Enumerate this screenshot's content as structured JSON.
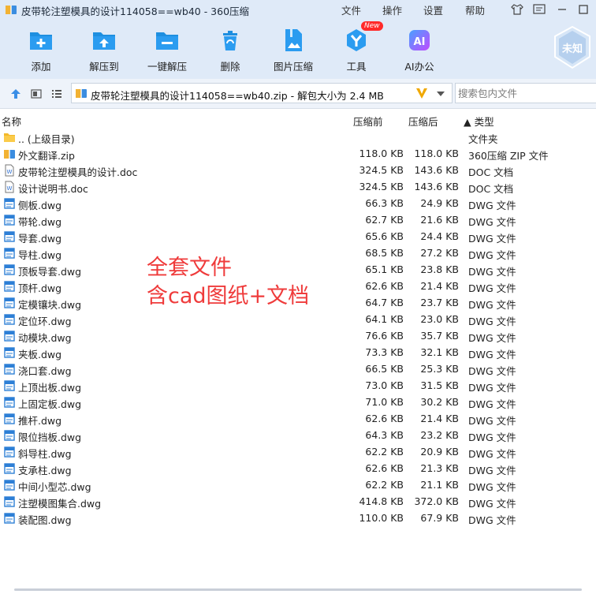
{
  "window": {
    "title": "皮带轮注塑模具的设计114058==wb40 - 360压缩",
    "menu": [
      "文件",
      "操作",
      "设置",
      "帮助"
    ]
  },
  "toolbar": [
    {
      "label": "添加",
      "icon": "add-icon"
    },
    {
      "label": "解压到",
      "icon": "extract-to-icon"
    },
    {
      "label": "一键解压",
      "icon": "one-click-extract-icon"
    },
    {
      "label": "删除",
      "icon": "delete-icon"
    },
    {
      "label": "图片压缩",
      "icon": "image-compress-icon"
    },
    {
      "label": "工具",
      "icon": "tools-icon",
      "badge": "New"
    },
    {
      "label": "AI办公",
      "icon": "ai-office-icon"
    }
  ],
  "user": {
    "avatar_text": "未知"
  },
  "pathbar": {
    "path": "皮带轮注塑模具的设计114058==wb40.zip - 解包大小为 2.4 MB",
    "search_placeholder": "搜索包内文件"
  },
  "columns": {
    "name": "名称",
    "original": "压缩前",
    "compressed": "压缩后",
    "type": "▲ 类型"
  },
  "files": [
    {
      "name": ".. (上级目录)",
      "size": "",
      "compressed": "",
      "type": "文件夹",
      "kind": "folder"
    },
    {
      "name": "外文翻译.zip",
      "size": "118.0 KB",
      "compressed": "118.0 KB",
      "type": "360压缩 ZIP 文件",
      "kind": "zip"
    },
    {
      "name": "皮带轮注塑模具的设计.doc",
      "size": "324.5 KB",
      "compressed": "143.6 KB",
      "type": "DOC 文档",
      "kind": "doc"
    },
    {
      "name": "设计说明书.doc",
      "size": "324.5 KB",
      "compressed": "143.6 KB",
      "type": "DOC 文档",
      "kind": "doc"
    },
    {
      "name": "侧板.dwg",
      "size": "66.3 KB",
      "compressed": "24.9 KB",
      "type": "DWG 文件",
      "kind": "dwg"
    },
    {
      "name": "带轮.dwg",
      "size": "62.7 KB",
      "compressed": "21.6 KB",
      "type": "DWG 文件",
      "kind": "dwg"
    },
    {
      "name": "导套.dwg",
      "size": "65.6 KB",
      "compressed": "24.4 KB",
      "type": "DWG 文件",
      "kind": "dwg"
    },
    {
      "name": "导柱.dwg",
      "size": "68.5 KB",
      "compressed": "27.2 KB",
      "type": "DWG 文件",
      "kind": "dwg"
    },
    {
      "name": "顶板导套.dwg",
      "size": "65.1 KB",
      "compressed": "23.8 KB",
      "type": "DWG 文件",
      "kind": "dwg"
    },
    {
      "name": "顶杆.dwg",
      "size": "62.6 KB",
      "compressed": "21.4 KB",
      "type": "DWG 文件",
      "kind": "dwg"
    },
    {
      "name": "定模镶块.dwg",
      "size": "64.7 KB",
      "compressed": "23.7 KB",
      "type": "DWG 文件",
      "kind": "dwg"
    },
    {
      "name": "定位环.dwg",
      "size": "64.1 KB",
      "compressed": "23.0 KB",
      "type": "DWG 文件",
      "kind": "dwg"
    },
    {
      "name": "动模块.dwg",
      "size": "76.6 KB",
      "compressed": "35.7 KB",
      "type": "DWG 文件",
      "kind": "dwg"
    },
    {
      "name": "夹板.dwg",
      "size": "73.3 KB",
      "compressed": "32.1 KB",
      "type": "DWG 文件",
      "kind": "dwg"
    },
    {
      "name": "浇口套.dwg",
      "size": "66.5 KB",
      "compressed": "25.3 KB",
      "type": "DWG 文件",
      "kind": "dwg"
    },
    {
      "name": "上顶出板.dwg",
      "size": "73.0 KB",
      "compressed": "31.5 KB",
      "type": "DWG 文件",
      "kind": "dwg"
    },
    {
      "name": "上固定板.dwg",
      "size": "71.0 KB",
      "compressed": "30.2 KB",
      "type": "DWG 文件",
      "kind": "dwg"
    },
    {
      "name": "推杆.dwg",
      "size": "62.6 KB",
      "compressed": "21.4 KB",
      "type": "DWG 文件",
      "kind": "dwg"
    },
    {
      "name": "限位挡板.dwg",
      "size": "64.3 KB",
      "compressed": "23.2 KB",
      "type": "DWG 文件",
      "kind": "dwg"
    },
    {
      "name": "斜导柱.dwg",
      "size": "62.2 KB",
      "compressed": "20.9 KB",
      "type": "DWG 文件",
      "kind": "dwg"
    },
    {
      "name": "支承柱.dwg",
      "size": "62.6 KB",
      "compressed": "21.3 KB",
      "type": "DWG 文件",
      "kind": "dwg"
    },
    {
      "name": "中间小型芯.dwg",
      "size": "62.2 KB",
      "compressed": "21.1 KB",
      "type": "DWG 文件",
      "kind": "dwg"
    },
    {
      "name": "注塑模图集合.dwg",
      "size": "414.8 KB",
      "compressed": "372.0 KB",
      "type": "DWG 文件",
      "kind": "dwg"
    },
    {
      "name": "装配图.dwg",
      "size": "110.0 KB",
      "compressed": "67.9 KB",
      "type": "DWG 文件",
      "kind": "dwg"
    }
  ],
  "overlay": {
    "line1": "全套文件",
    "line2": "含cad图纸+文档"
  },
  "colors": {
    "accent": "#1e8fe0",
    "overlay": "#ef3b3b"
  }
}
